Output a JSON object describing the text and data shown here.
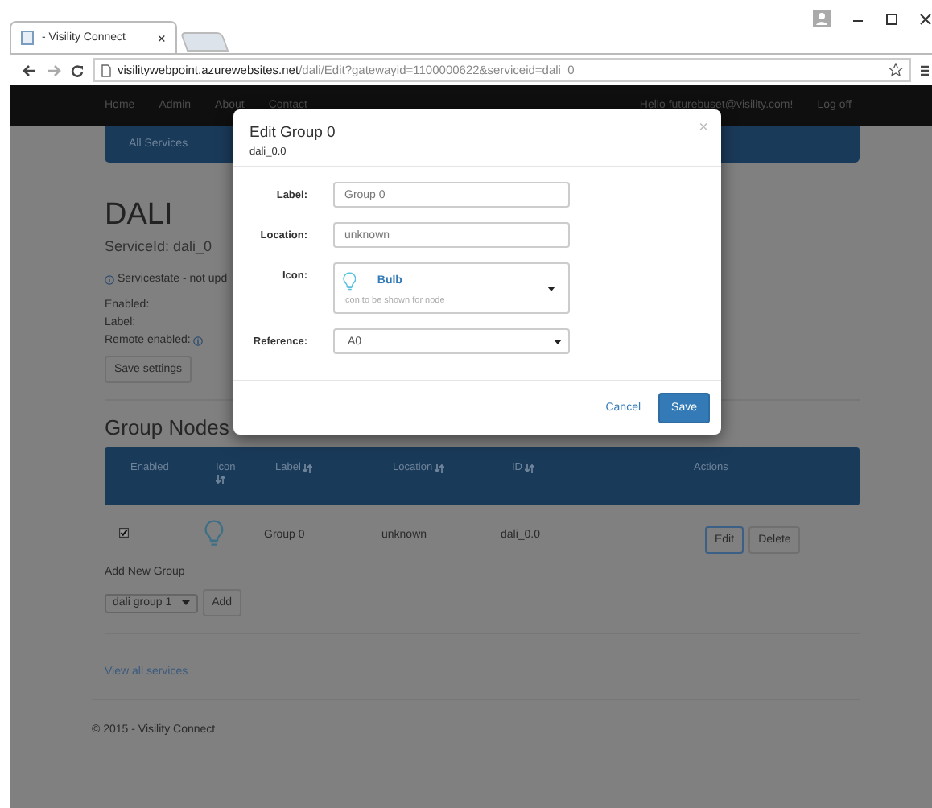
{
  "browser": {
    "tab_title": "- Visility Connect",
    "tab_close": "×",
    "url_host": "visilitywebpoint.azurewebsites.net",
    "url_path": "/dali/Edit?gatewayid=1100000622&serviceid=dali_0"
  },
  "nav": {
    "items": [
      "Home",
      "Admin",
      "About",
      "Contact"
    ],
    "greeting": "Hello futurebuset@visility.com!",
    "logout": "Log off"
  },
  "services_bar": {
    "label": "All Services"
  },
  "service": {
    "title": "DALI",
    "service_id": "ServiceId: dali_0",
    "state": "Servicestate - not upd",
    "fields": [
      {
        "label": "Enabled:",
        "info": false
      },
      {
        "label": "Label:",
        "info": false
      },
      {
        "label": "Remote enabled:",
        "info": true
      }
    ],
    "save_button": "Save settings"
  },
  "group_nodes": {
    "title": "Group Nodes",
    "columns": [
      {
        "label": "Enabled",
        "sortable": false
      },
      {
        "label": "Icon",
        "sortable": true
      },
      {
        "label": "Label",
        "sortable": true
      },
      {
        "label": "Location",
        "sortable": true
      },
      {
        "label": "ID",
        "sortable": true
      },
      {
        "label": "Actions",
        "sortable": false
      }
    ],
    "rows": [
      {
        "enabled": true,
        "label": "Group 0",
        "location": "unknown",
        "id": "dali_0.0",
        "actions": [
          {
            "label": "Edit",
            "focused": true
          },
          {
            "label": "Delete",
            "focused": false
          }
        ]
      }
    ]
  },
  "add_group": {
    "title": "Add New Group",
    "select": "dali group 1",
    "button": "Add"
  },
  "view_all_link": "View all services",
  "footer": "© 2015 - Visility Connect",
  "modal": {
    "title": "Edit Group 0",
    "subtitle": "dali_0.0",
    "close": "×",
    "fields": [
      {
        "kind": "text",
        "label": "Label:",
        "value": "Group 0"
      },
      {
        "kind": "text",
        "label": "Location:",
        "value": "unknown"
      },
      {
        "kind": "icon",
        "label": "Icon:",
        "value": "Bulb",
        "hint": "Icon to be shown for node"
      },
      {
        "kind": "select",
        "label": "Reference:",
        "value": "A0"
      }
    ],
    "cancel": "Cancel",
    "save": "Save"
  }
}
